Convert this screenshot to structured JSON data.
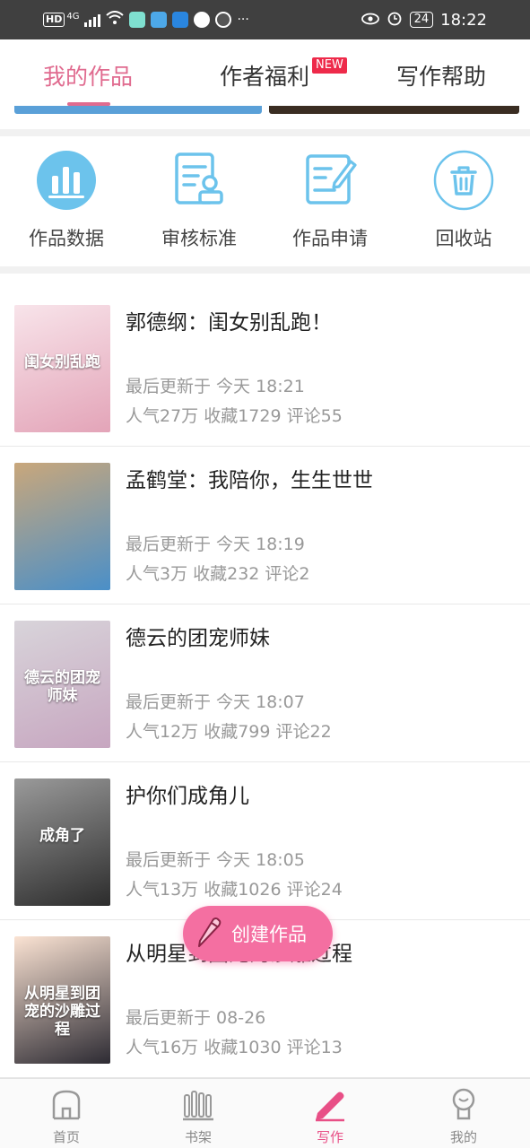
{
  "status_bar": {
    "network": "HD",
    "network_type": "4G",
    "battery": "24",
    "time": "18:22",
    "icons_left": [
      "signal-icon",
      "wifi-icon",
      "app-icon",
      "app-icon",
      "app-icon",
      "chat-icon",
      "app-icon",
      "more-icon"
    ],
    "icons_right": [
      "eye-icon",
      "alarm-icon",
      "battery-icon"
    ]
  },
  "tabs": [
    {
      "label": "我的作品",
      "active": true
    },
    {
      "label": "作者福利",
      "active": false,
      "badge": "NEW"
    },
    {
      "label": "写作帮助",
      "active": false
    }
  ],
  "tools": [
    {
      "label": "作品数据",
      "icon": "bar-chart-icon"
    },
    {
      "label": "审核标准",
      "icon": "review-standard-icon"
    },
    {
      "label": "作品申请",
      "icon": "edit-document-icon"
    },
    {
      "label": "回收站",
      "icon": "trash-icon"
    }
  ],
  "works": [
    {
      "title": "郭德纲：闺女别乱跑！",
      "update": "最后更新于 今天 18:21",
      "stats": "人气27万 收藏1729 评论55",
      "cover_text": "闺女别乱跑",
      "cover_colors": [
        "#f8e4ea",
        "#e3a4b8"
      ]
    },
    {
      "title": "孟鹤堂：我陪你，生生世世",
      "update": "最后更新于 今天 18:19",
      "stats": "人气3万 收藏232 评论2",
      "cover_text": "",
      "cover_colors": [
        "#c9a77b",
        "#4a8fc8"
      ]
    },
    {
      "title": "德云的团宠师妹",
      "update": "最后更新于 今天 18:07",
      "stats": "人气12万 收藏799 评论22",
      "cover_text": "德云的团宠师妹",
      "cover_colors": [
        "#d8d4da",
        "#c7a6c0"
      ]
    },
    {
      "title": "护你们成角儿",
      "update": "最后更新于 今天 18:05",
      "stats": "人气13万 收藏1026 评论24",
      "cover_text": "成角了",
      "cover_colors": [
        "#9a9a9a",
        "#2c2c2c"
      ]
    },
    {
      "title": "从明星到团宠的沙雕过程",
      "update": "最后更新于 08-26",
      "stats": "人气16万 收藏1030 评论13",
      "cover_text": "从明星到团宠的沙雕过程",
      "cover_colors": [
        "#fbe3d3",
        "#2d2b33"
      ]
    }
  ],
  "fab": {
    "label": "创建作品",
    "icon": "pencil-icon"
  },
  "bottom_nav": [
    {
      "label": "首页",
      "icon": "home-icon",
      "active": false
    },
    {
      "label": "书架",
      "icon": "bookshelf-icon",
      "active": false
    },
    {
      "label": "写作",
      "icon": "write-pen-icon",
      "active": true
    },
    {
      "label": "我的",
      "icon": "profile-icon",
      "active": false
    }
  ],
  "colors": {
    "accent": "#e06b8f",
    "fab": "#f46fa1",
    "icon_blue": "#6cc3ec",
    "badge": "#ee2a4a"
  }
}
